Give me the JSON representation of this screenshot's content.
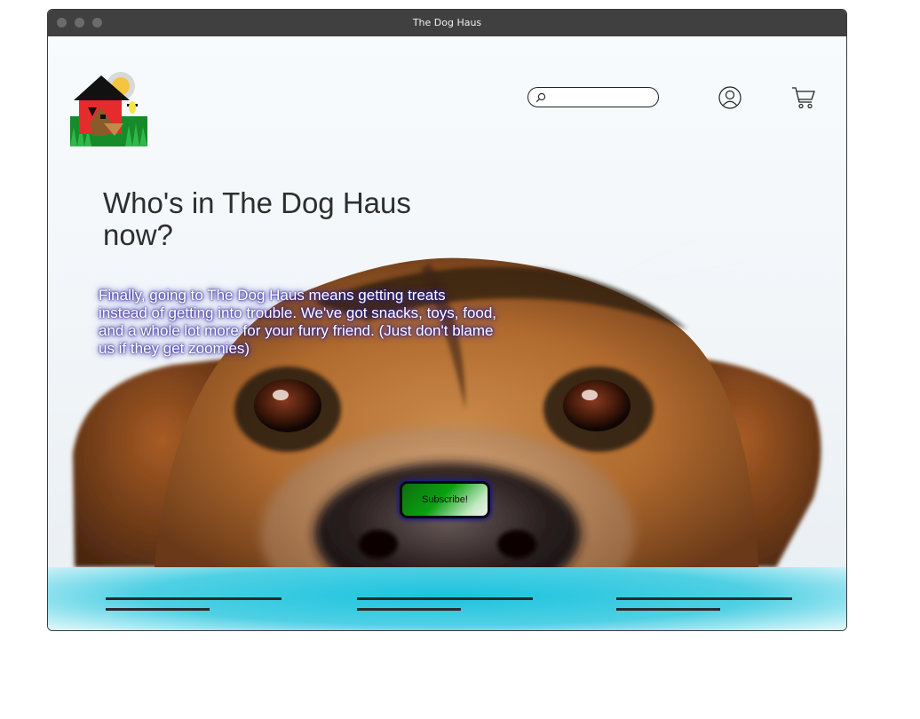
{
  "window": {
    "title": "The Dog Haus"
  },
  "header": {
    "logo_icon": "dog-house-logo-icon",
    "search": {
      "value": "",
      "placeholder": "",
      "icon": "search-icon"
    },
    "account_icon": "user-account-icon",
    "cart_icon": "shopping-cart-icon"
  },
  "hero": {
    "headline": "Who's in The Dog Haus now?",
    "tagline": "Finally, going to The Dog Haus means getting treats instead of getting into trouble. We've got snacks, toys, food, and a whole lot more for your furry friend. (Just don't blame us if they get zoomies)",
    "subscribe_label": "Subscribe!",
    "background_image": "dog-face-photo"
  },
  "footer": {
    "columns": 3,
    "placeholder_lines": "text-line-placeholders"
  },
  "colors": {
    "titlebar": "#404040",
    "subscribe_green": "#0aa010",
    "footer_cyan": "#1cc3de",
    "tagline_glow": "#2a1f9a"
  }
}
